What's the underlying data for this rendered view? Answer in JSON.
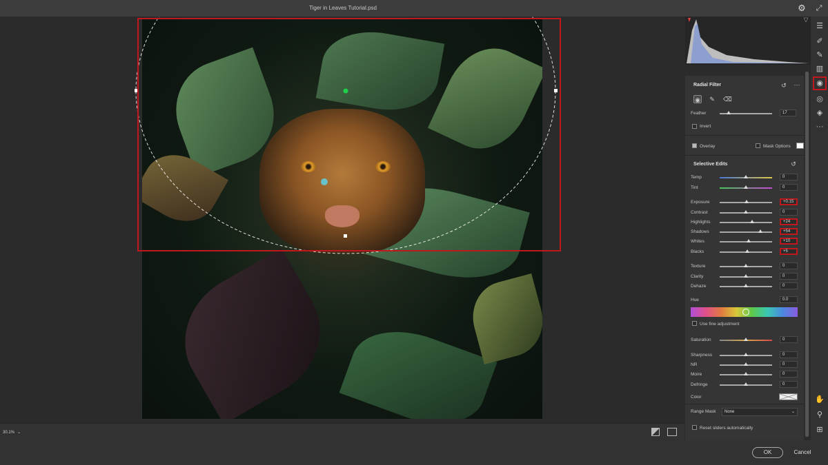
{
  "window": {
    "title": "Tiger in Leaves Tutorial.psd"
  },
  "status": {
    "zoom": "30.1%",
    "zoom_chevron": "⌄"
  },
  "footer": {
    "ok_label": "OK",
    "cancel_label": "Cancel"
  },
  "radial_filter": {
    "title": "Radial Filter",
    "feather_label": "Feather",
    "feather_value": "17",
    "feather_level": 0.17,
    "invert_label": "Invert",
    "invert_checked": false,
    "overlay_label": "Overlay",
    "overlay_checked": true,
    "mask_options_label": "Mask Options",
    "more_label": "···"
  },
  "selective_edits": {
    "title": "Selective Edits",
    "temp": {
      "label": "Temp",
      "value": "0",
      "level": 0.5
    },
    "tint": {
      "label": "Tint",
      "value": "0",
      "level": 0.5
    },
    "exposure": {
      "label": "Exposure",
      "value": "+0.15",
      "level": 0.51,
      "highlighted": true
    },
    "contrast": {
      "label": "Contrast",
      "value": "0",
      "level": 0.5
    },
    "highlights": {
      "label": "Highlights",
      "value": "+24",
      "level": 0.62,
      "highlighted": true
    },
    "shadows": {
      "label": "Shadows",
      "value": "+54",
      "level": 0.77,
      "highlighted": true
    },
    "whites": {
      "label": "Whites",
      "value": "+10",
      "level": 0.55,
      "highlighted": true
    },
    "blacks": {
      "label": "Blacks",
      "value": "+5",
      "level": 0.53,
      "highlighted": true
    },
    "texture": {
      "label": "Texture",
      "value": "0",
      "level": 0.5
    },
    "clarity": {
      "label": "Clarity",
      "value": "0",
      "level": 0.5
    },
    "dehaze": {
      "label": "Dehaze",
      "value": "0",
      "level": 0.5
    },
    "hue": {
      "label": "Hue",
      "value": "0.0"
    },
    "fine_adjust_label": "Use fine adjustment",
    "saturation": {
      "label": "Saturation",
      "value": "0",
      "level": 0.5
    },
    "sharpness": {
      "label": "Sharpness",
      "value": "0",
      "level": 0.5
    },
    "nr": {
      "label": "NR",
      "value": "0",
      "level": 0.5
    },
    "moire": {
      "label": "Moire",
      "value": "0",
      "level": 0.5
    },
    "defringe": {
      "label": "Defringe",
      "value": "0",
      "level": 0.5
    },
    "color_label": "Color",
    "range_mask_label": "Range Mask",
    "range_mask_value": "None",
    "reset_label": "Reset sliders automatically"
  },
  "toolstrip": {
    "tools": [
      "edit-sliders-icon",
      "healing-brush-icon",
      "brush-icon",
      "linear-gradient-icon",
      "radial-filter-icon",
      "red-eye-icon",
      "presets-icon",
      "more-icon"
    ]
  },
  "colors": {
    "highlight": "#c0181c",
    "panel_bg": "#353535",
    "accent_pin": "#1fd14a"
  }
}
